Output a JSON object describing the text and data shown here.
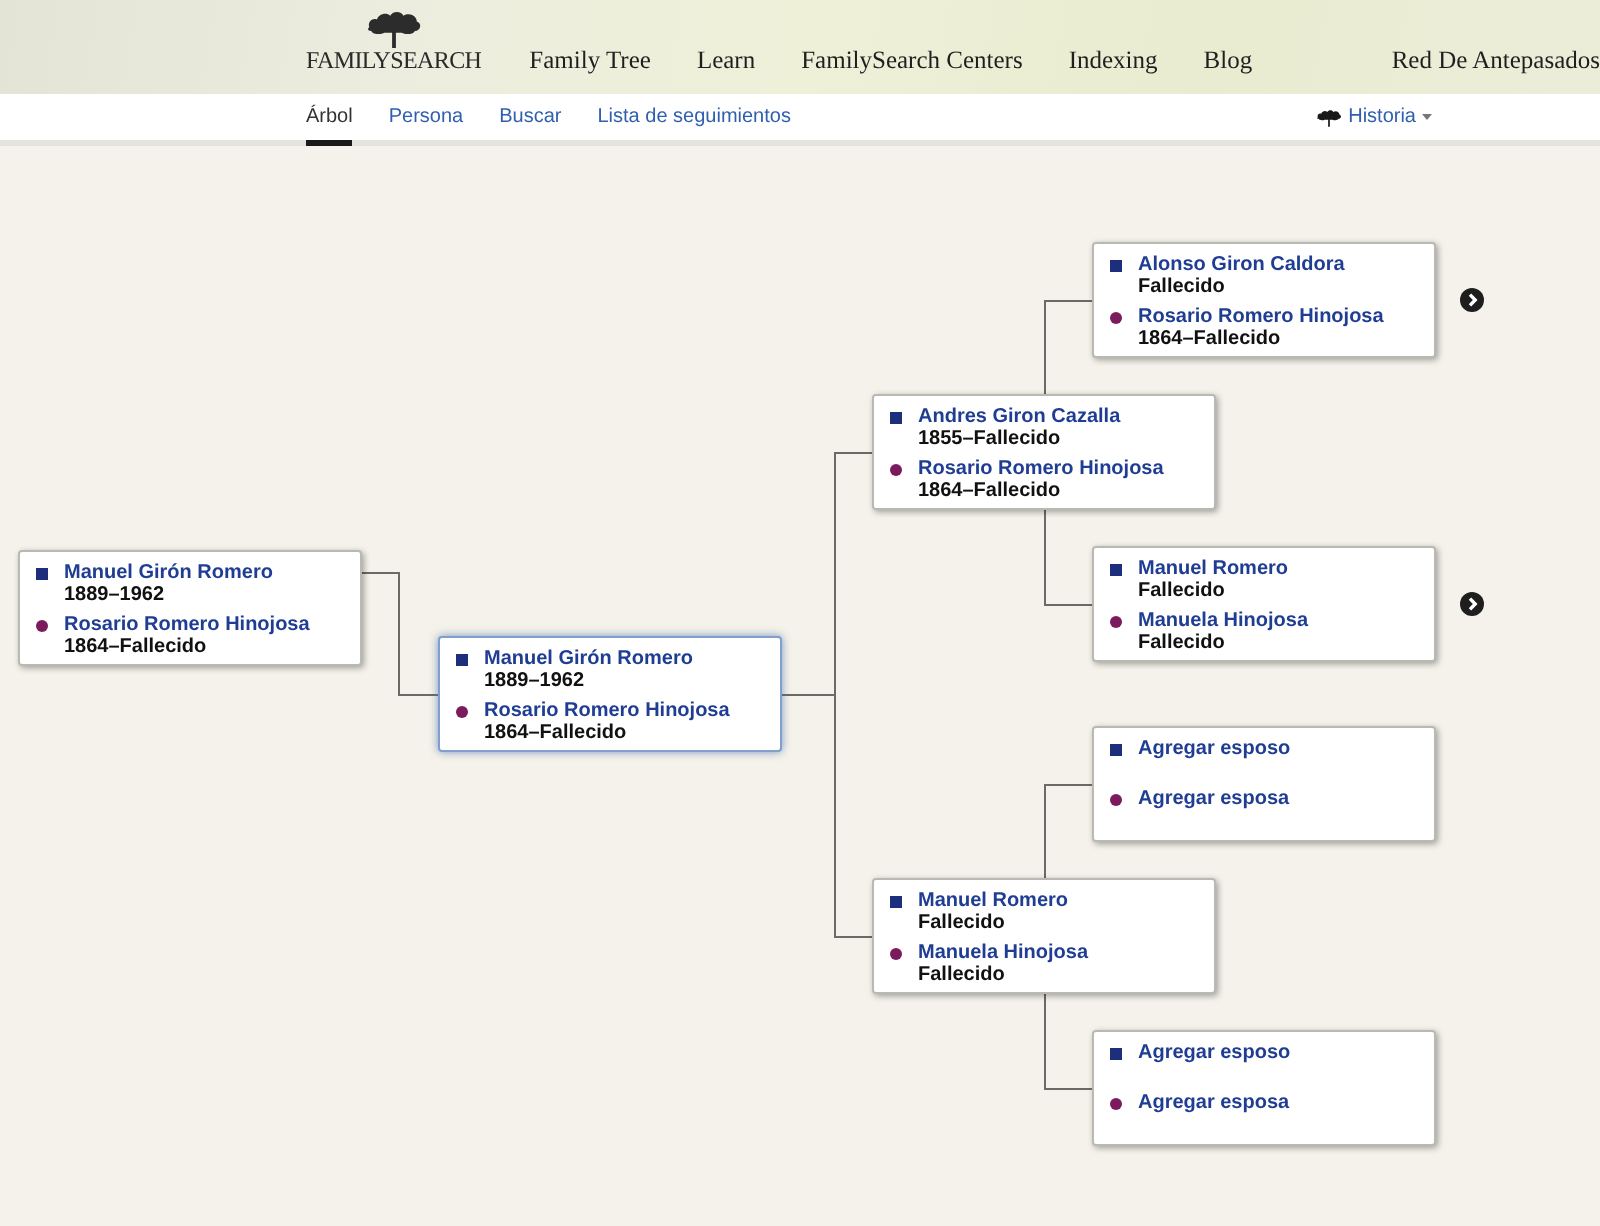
{
  "header": {
    "logo": "FAMILYSEARCH",
    "nav": [
      "Family Tree",
      "Learn",
      "FamilySearch Centers",
      "Indexing",
      "Blog",
      "Red De Antepasados"
    ]
  },
  "subnav": {
    "tabs": [
      {
        "label": "Árbol",
        "selected": true
      },
      {
        "label": "Persona",
        "selected": false
      },
      {
        "label": "Buscar",
        "selected": false
      },
      {
        "label": "Lista de seguimientos",
        "selected": false
      }
    ],
    "history": {
      "label": "Historia"
    }
  },
  "tree": {
    "root": {
      "selected": false,
      "more": false,
      "persons": [
        {
          "kind": "male",
          "name": "Manuel Girón Romero",
          "dates": "1889–1962"
        },
        {
          "kind": "female",
          "name": "Rosario Romero Hinojosa",
          "dates": "1864–Fallecido"
        }
      ],
      "children": [
        {
          "selected": true,
          "more": false,
          "persons": [
            {
              "kind": "male",
              "name": "Manuel Girón Romero",
              "dates": "1889–1962"
            },
            {
              "kind": "female",
              "name": "Rosario Romero Hinojosa",
              "dates": "1864–Fallecido"
            }
          ],
          "children": [
            {
              "selected": false,
              "more": false,
              "persons": [
                {
                  "kind": "male",
                  "name": "Andres Giron Cazalla",
                  "dates": "1855–Fallecido"
                },
                {
                  "kind": "female",
                  "name": "Rosario Romero Hinojosa",
                  "dates": "1864–Fallecido"
                }
              ],
              "children": [
                {
                  "selected": false,
                  "more": true,
                  "persons": [
                    {
                      "kind": "male",
                      "name": "Alonso Giron Caldora",
                      "dates": "Fallecido"
                    },
                    {
                      "kind": "female",
                      "name": "Rosario Romero Hinojosa",
                      "dates": "1864–Fallecido"
                    }
                  ]
                },
                {
                  "selected": false,
                  "more": true,
                  "persons": [
                    {
                      "kind": "male",
                      "name": "Manuel Romero",
                      "dates": "Fallecido"
                    },
                    {
                      "kind": "female",
                      "name": "Manuela Hinojosa",
                      "dates": "Fallecido"
                    }
                  ]
                }
              ]
            },
            {
              "selected": false,
              "more": false,
              "persons": [
                {
                  "kind": "male",
                  "name": "Manuel Romero",
                  "dates": "Fallecido"
                },
                {
                  "kind": "female",
                  "name": "Manuela Hinojosa",
                  "dates": "Fallecido"
                }
              ],
              "children": [
                {
                  "selected": false,
                  "more": false,
                  "persons": [
                    {
                      "kind": "male",
                      "name": "Agregar esposo"
                    },
                    {
                      "kind": "female",
                      "name": "Agregar esposa"
                    }
                  ]
                },
                {
                  "selected": false,
                  "more": false,
                  "persons": [
                    {
                      "kind": "male",
                      "name": "Agregar esposo"
                    },
                    {
                      "kind": "female",
                      "name": "Agregar esposa"
                    }
                  ]
                }
              ]
            }
          ]
        }
      ]
    }
  }
}
